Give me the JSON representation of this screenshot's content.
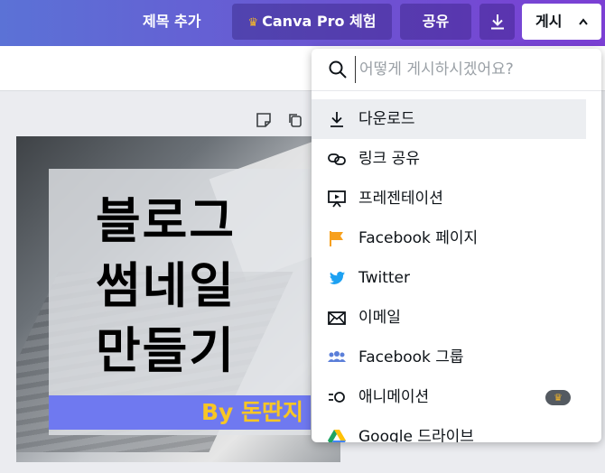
{
  "header": {
    "title_label": "제목 추가",
    "pro_label": "Canva Pro 체험",
    "share_label": "공유",
    "publish_label": "게시",
    "accent_gradient": [
      "#5b72d6",
      "#7b3fd4"
    ]
  },
  "design": {
    "headline_lines": [
      "블로그",
      "썸네일",
      "만들기"
    ],
    "byline": "By 돈딴지",
    "byline_bg": "#6f79f0",
    "byline_color": "#f8c624"
  },
  "publish_menu": {
    "search_placeholder": "어떻게 게시하시겠어요?",
    "items": [
      {
        "label": "다운로드",
        "icon": "download-icon",
        "highlighted": true
      },
      {
        "label": "링크 공유",
        "icon": "link-icon"
      },
      {
        "label": "프레젠테이션",
        "icon": "presentation-icon"
      },
      {
        "label": "Facebook 페이지",
        "icon": "flag-icon",
        "icon_color": "#f7a01d"
      },
      {
        "label": "Twitter",
        "icon": "twitter-bird-icon",
        "icon_color": "#1da1f2"
      },
      {
        "label": "이메일",
        "icon": "envelope-icon"
      },
      {
        "label": "Facebook 그룹",
        "icon": "group-icon",
        "icon_color": "#5b7fd9"
      },
      {
        "label": "애니메이션",
        "icon": "animation-icon",
        "pro_badge": true
      },
      {
        "label": "Google 드라이브",
        "icon": "google-drive-icon"
      }
    ]
  }
}
